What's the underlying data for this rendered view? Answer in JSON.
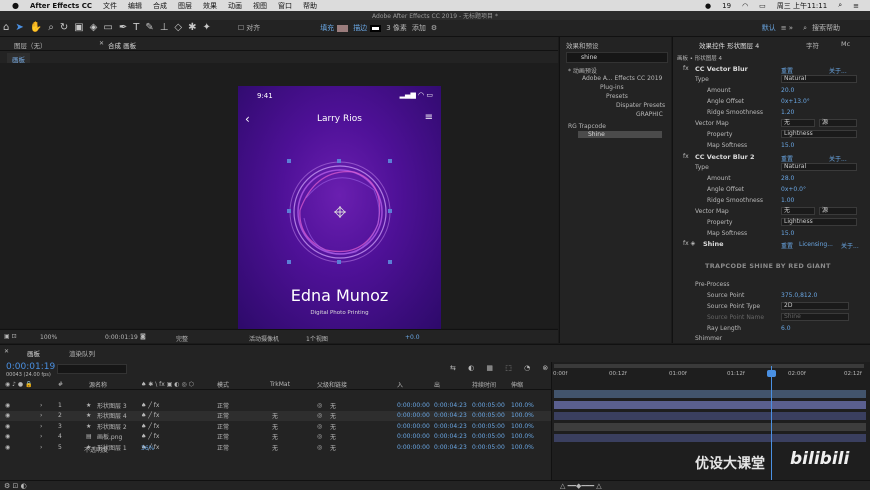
{
  "menubar": {
    "apple": "",
    "app": "After Effects CC",
    "items": [
      "文件",
      "编辑",
      "合成",
      "图层",
      "效果",
      "动画",
      "视图",
      "窗口",
      "帮助"
    ],
    "status": "19",
    "clock": "周三 上午11:11"
  },
  "titlebar": {
    "title": "Adobe After Effects CC 2019 - 无标题项目 *"
  },
  "toolbar": {
    "align": "对齐",
    "fill": "填充",
    "stroke": "描边",
    "stroke_px": "3 像素",
    "add": "添加",
    "workspace": "默认",
    "search": "搜索帮助",
    "fill_color": "#9a7c7c",
    "stroke_color": "#ffffff"
  },
  "left_panels": {
    "layer_tab": "图层（无）",
    "comp_tab": "合成 画板",
    "flowchart_tab": "画板"
  },
  "phone": {
    "time": "9:41",
    "name": "Larry Rios",
    "headline": "Edna Munoz",
    "subtitle": "Digital Photo Printing"
  },
  "viewer": {
    "zoom": "100%",
    "timecode": "0:00:01:19",
    "quality": "完整",
    "camera": "活动摄像机",
    "views": "1个视图",
    "exposure": "+0.0"
  },
  "effects_panel": {
    "title": "效果和预设",
    "search": "shine",
    "tree": [
      "* 动画预设",
      "Adobe A... Effects CC 2019",
      "Plug-ins",
      "Presets",
      "Dispater Presets",
      "GRAPHIC",
      "RG Trapcode",
      "Shine"
    ]
  },
  "effect_controls": {
    "title": "效果控件 形状图层 4",
    "tab2": "字符",
    "tab3": "Mc",
    "path": "画板 • 形状图层 4",
    "blur1": {
      "name": "CC Vector Blur",
      "reset": "重置",
      "about": "关于...",
      "type_label": "Type",
      "type": "Natural",
      "amount_label": "Amount",
      "amount": "20.0",
      "angle_label": "Angle Offset",
      "angle": "0x+13.0°",
      "ridge_label": "Ridge Smoothness",
      "ridge": "1.20",
      "vmap_label": "Vector Map",
      "vmap": "无",
      "vmap2": "源",
      "prop_label": "Property",
      "prop": "Lightness",
      "soft_label": "Map Softness",
      "soft": "15.0"
    },
    "blur2": {
      "name": "CC Vector Blur 2",
      "reset": "重置",
      "about": "关于...",
      "type_label": "Type",
      "type": "Natural",
      "amount_label": "Amount",
      "amount": "28.0",
      "angle_label": "Angle Offset",
      "angle": "0x+0.0°",
      "ridge_label": "Ridge Smoothness",
      "ridge": "1.00",
      "vmap_label": "Vector Map",
      "vmap": "无",
      "vmap2": "源",
      "prop_label": "Property",
      "prop": "Lightness",
      "soft_label": "Map Softness",
      "soft": "15.0"
    },
    "shine": {
      "name": "Shine",
      "reset": "重置",
      "licensing": "Licensing...",
      "about": "关于...",
      "logo": "TRAPCODE SHINE BY RED GIANT",
      "pre": "Pre-Process",
      "sp_label": "Source Point",
      "sp": "375.0,812.0",
      "spt_label": "Source Point Type",
      "spt": "2D",
      "spn_label": "Source Point Name",
      "spn": "Shine",
      "ray_label": "Ray Length",
      "ray": "6.0",
      "shimmer": "Shimmer"
    }
  },
  "timeline": {
    "tab": "画板",
    "render_tab": "渲染队列",
    "timecode": "0:00:01:19",
    "fps": "00043 (24.00 fps)",
    "headers": {
      "num": "#",
      "name": "源名称",
      "mode": "模式",
      "trkmat": "TrkMat",
      "parent": "父级和链接",
      "in": "入",
      "out": "出",
      "dur": "持续时间",
      "stretch": "伸缩"
    },
    "layers": [
      {
        "num": "1",
        "name": "形状图层 3",
        "mode": "正常",
        "trk": "",
        "parent": "无",
        "in": "0:00:00:00",
        "out": "0:00:04:23",
        "dur": "0:00:05:00",
        "stretch": "100.0%"
      },
      {
        "num": "2",
        "name": "形状图层 4",
        "mode": "正常",
        "trk": "无",
        "parent": "无",
        "in": "0:00:00:00",
        "out": "0:00:04:23",
        "dur": "0:00:05:00",
        "stretch": "100.0%"
      },
      {
        "num": "3",
        "name": "形状图层 2",
        "mode": "正常",
        "trk": "无",
        "parent": "无",
        "in": "0:00:00:00",
        "out": "0:00:04:23",
        "dur": "0:00:05:00",
        "stretch": "100.0%"
      },
      {
        "num": "4",
        "name": "画板.png",
        "mode": "正常",
        "trk": "无",
        "parent": "无",
        "in": "0:00:00:00",
        "out": "0:00:04:23",
        "dur": "0:00:05:00",
        "stretch": "100.0%"
      },
      {
        "num": "5",
        "name": "形状图层 1",
        "mode": "正常",
        "trk": "无",
        "parent": "无",
        "in": "0:00:00:00",
        "out": "0:00:04:23",
        "dur": "0:00:05:00",
        "stretch": "100.0%"
      }
    ],
    "opacity_label": "不透明度",
    "opacity": "36%",
    "ruler": [
      "0:00f",
      "00:12f",
      "01:00f",
      "01:12f",
      "02:00f",
      "02:12f"
    ]
  },
  "watermark": {
    "text": "优设大课堂",
    "logo": "bilibili"
  }
}
